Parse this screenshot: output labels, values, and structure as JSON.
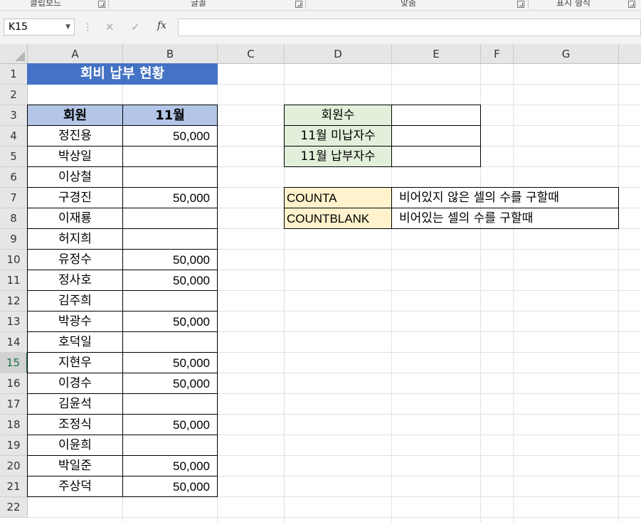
{
  "ribbon": {
    "groups": [
      "클립보드",
      "글꼴",
      "맞춤",
      "표시 형식"
    ]
  },
  "formula_bar": {
    "name_box": "K15",
    "cancel_icon": "✕",
    "enter_icon": "✓",
    "fx_label": "fx",
    "formula_value": ""
  },
  "sheet": {
    "columns": [
      "A",
      "B",
      "C",
      "D",
      "E",
      "F",
      "G"
    ],
    "rows": [
      "1",
      "2",
      "3",
      "4",
      "5",
      "6",
      "7",
      "8",
      "9",
      "10",
      "11",
      "12",
      "13",
      "14",
      "15",
      "16",
      "17",
      "18",
      "19",
      "20",
      "21",
      "22"
    ],
    "active_row": "15",
    "active_cell": "K15",
    "title": "회비 납부 현황",
    "header": {
      "member": "회원",
      "month": "11월"
    },
    "members": [
      {
        "name": "정진용",
        "paid": "50,000"
      },
      {
        "name": "박상일",
        "paid": ""
      },
      {
        "name": "이상철",
        "paid": ""
      },
      {
        "name": "구경진",
        "paid": "50,000"
      },
      {
        "name": "이재룡",
        "paid": ""
      },
      {
        "name": "허지희",
        "paid": ""
      },
      {
        "name": "유정수",
        "paid": "50,000"
      },
      {
        "name": "정사호",
        "paid": "50,000"
      },
      {
        "name": "김주희",
        "paid": ""
      },
      {
        "name": "박광수",
        "paid": "50,000"
      },
      {
        "name": "호덕일",
        "paid": ""
      },
      {
        "name": "지현우",
        "paid": "50,000"
      },
      {
        "name": "이경수",
        "paid": "50,000"
      },
      {
        "name": "김윤석",
        "paid": ""
      },
      {
        "name": "조정식",
        "paid": "50,000"
      },
      {
        "name": "이윤희",
        "paid": ""
      },
      {
        "name": "박일준",
        "paid": "50,000"
      },
      {
        "name": "주상덕",
        "paid": "50,000"
      }
    ],
    "summary": [
      {
        "label": "회원수",
        "value": ""
      },
      {
        "label": "11월 미납자수",
        "value": ""
      },
      {
        "label": "11월 납부자수",
        "value": ""
      }
    ],
    "functions": [
      {
        "name": "COUNTA",
        "desc": "비어있지 않은 셀의 수를 구할때"
      },
      {
        "name": "COUNTBLANK",
        "desc": "비어있는 셀의 수를 구할때"
      }
    ],
    "colors": {
      "title_bg": "#4472c4",
      "header_bg": "#b4c6e7",
      "summary_bg": "#e2efda",
      "function_bg": "#fff2cc",
      "active_row_text": "#1e7145"
    }
  }
}
